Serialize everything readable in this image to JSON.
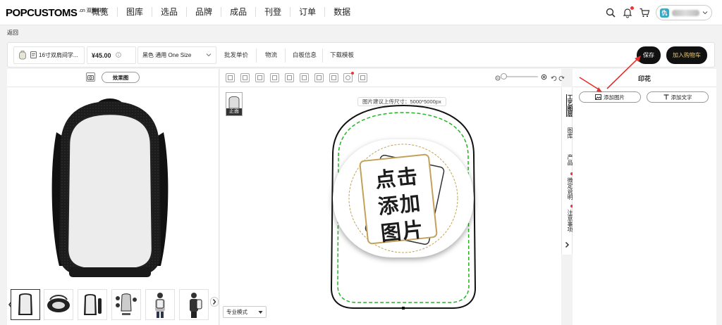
{
  "nav": {
    "logo": "POPCUSTOMS",
    "logo_sub": ".cn 双腾科技",
    "items": [
      "概览",
      "图库",
      "选品",
      "品牌",
      "成品",
      "刊登",
      "订单",
      "数据"
    ],
    "user_initial": "仇"
  },
  "back_label": "返回",
  "toolbar": {
    "product_name": "16寸双肩间学...",
    "price": "¥45.00",
    "variant": "黑色 通用 One Size",
    "links": [
      "批发单价",
      "物流",
      "白板信息",
      "下载模板"
    ],
    "save_label": "保存",
    "add_cart_label": "加入购物车"
  },
  "left": {
    "effect_label": "效果图"
  },
  "canvas": {
    "view_label": "正面",
    "hint": "图片建议上传尺寸：5000*5000px",
    "placeholder_lines": [
      "点击",
      "添加",
      "图片"
    ],
    "mode_label": "专业模式"
  },
  "side_tabs": [
    {
      "label": "工艺图层",
      "dot": false
    },
    {
      "label": "图库",
      "dot": false
    },
    {
      "label": "产品",
      "dot": false
    },
    {
      "label": "微定说明",
      "dot": true
    },
    {
      "label": "注意事项",
      "dot": true
    }
  ],
  "right": {
    "title": "印花",
    "add_image_label": "添加图片",
    "add_text_label": "添加文字"
  },
  "colors": {
    "accent_gold": "#c2a25a",
    "annotation_red": "#e53030",
    "safe_line_green": "#22b522"
  }
}
